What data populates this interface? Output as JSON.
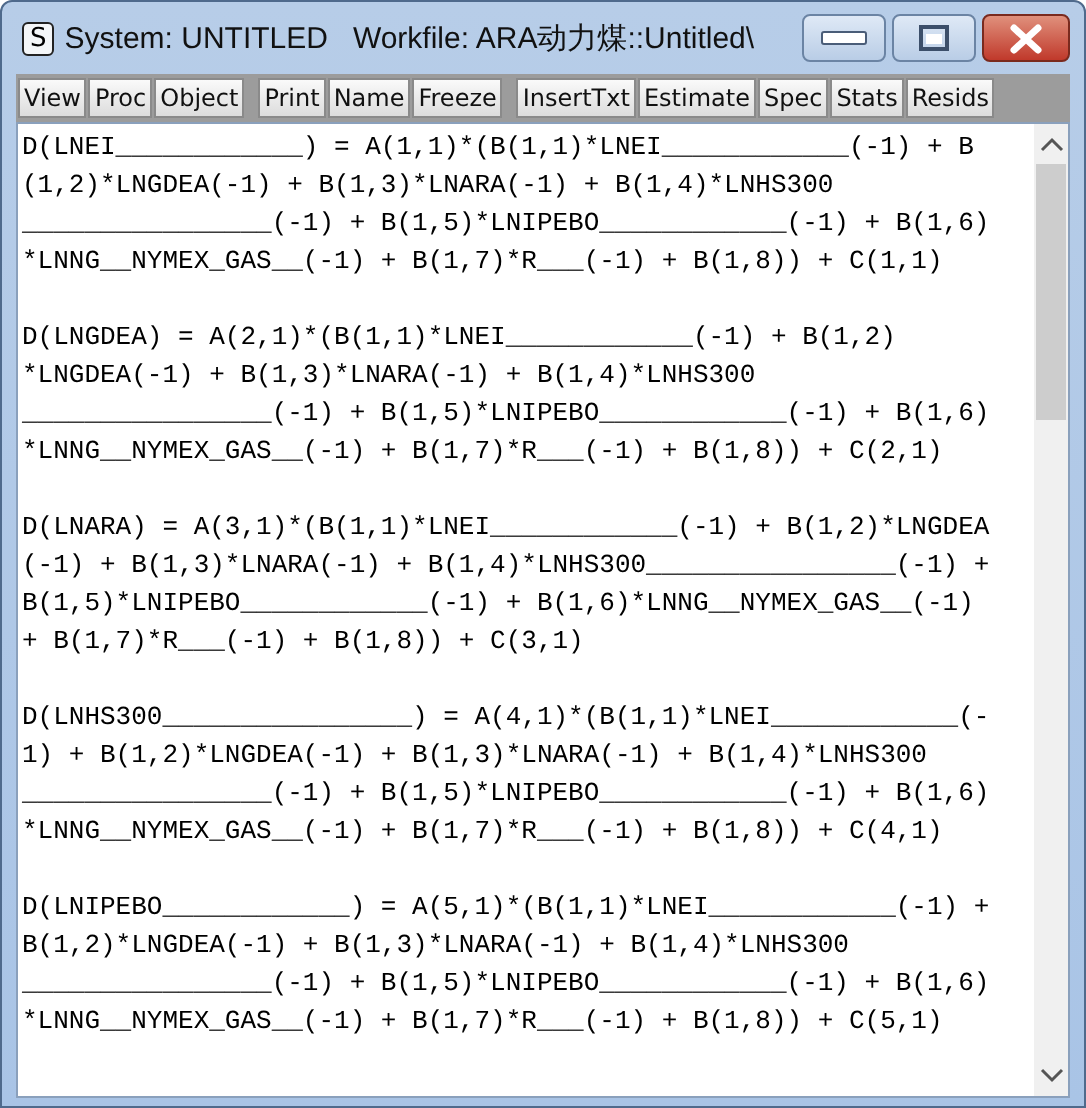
{
  "window": {
    "icon": "S",
    "title": "System: UNTITLED   Workfile: ARA动力煤::Untitled\\"
  },
  "toolbar_groups": [
    [
      "View",
      "Proc",
      "Object"
    ],
    [
      "Print",
      "Name",
      "Freeze"
    ],
    [
      "InsertTxt",
      "Estimate",
      "Spec",
      "Stats",
      "Resids"
    ]
  ],
  "equations": [
    {
      "lines": [
        "D(LNEI____________) = A(1,1)*(B(1,1)*LNEI____________(-1) + B",
        "(1,2)*LNGDEA(-1) + B(1,3)*LNARA(-1) + B(1,4)*LNHS300",
        "________________(-1) + B(1,5)*LNIPEBO____________(-1) + B(1,6)",
        "*LNNG__NYMEX_GAS__(-1) + B(1,7)*R___(-1) + B(1,8)) + C(1,1)"
      ]
    },
    {
      "lines": [
        "D(LNGDEA) = A(2,1)*(B(1,1)*LNEI____________(-1) + B(1,2)",
        "*LNGDEA(-1) + B(1,3)*LNARA(-1) + B(1,4)*LNHS300",
        "________________(-1) + B(1,5)*LNIPEBO____________(-1) + B(1,6)",
        "*LNNG__NYMEX_GAS__(-1) + B(1,7)*R___(-1) + B(1,8)) + C(2,1)"
      ]
    },
    {
      "lines": [
        "D(LNARA) = A(3,1)*(B(1,1)*LNEI____________(-1) + B(1,2)*LNGDEA",
        "(-1) + B(1,3)*LNARA(-1) + B(1,4)*LNHS300________________(-1) +",
        "B(1,5)*LNIPEBO____________(-1) + B(1,6)*LNNG__NYMEX_GAS__(-1)",
        "+ B(1,7)*R___(-1) + B(1,8)) + C(3,1)"
      ]
    },
    {
      "lines": [
        "D(LNHS300________________) = A(4,1)*(B(1,1)*LNEI____________(-",
        "1) + B(1,2)*LNGDEA(-1) + B(1,3)*LNARA(-1) + B(1,4)*LNHS300",
        "________________(-1) + B(1,5)*LNIPEBO____________(-1) + B(1,6)",
        "*LNNG__NYMEX_GAS__(-1) + B(1,7)*R___(-1) + B(1,8)) + C(4,1)"
      ]
    },
    {
      "lines": [
        "D(LNIPEBO____________) = A(5,1)*(B(1,1)*LNEI____________(-1) +",
        "B(1,2)*LNGDEA(-1) + B(1,3)*LNARA(-1) + B(1,4)*LNHS300",
        "________________(-1) + B(1,5)*LNIPEBO____________(-1) + B(1,6)",
        "*LNNG__NYMEX_GAS__(-1) + B(1,7)*R___(-1) + B(1,8)) + C(5,1)"
      ]
    }
  ]
}
